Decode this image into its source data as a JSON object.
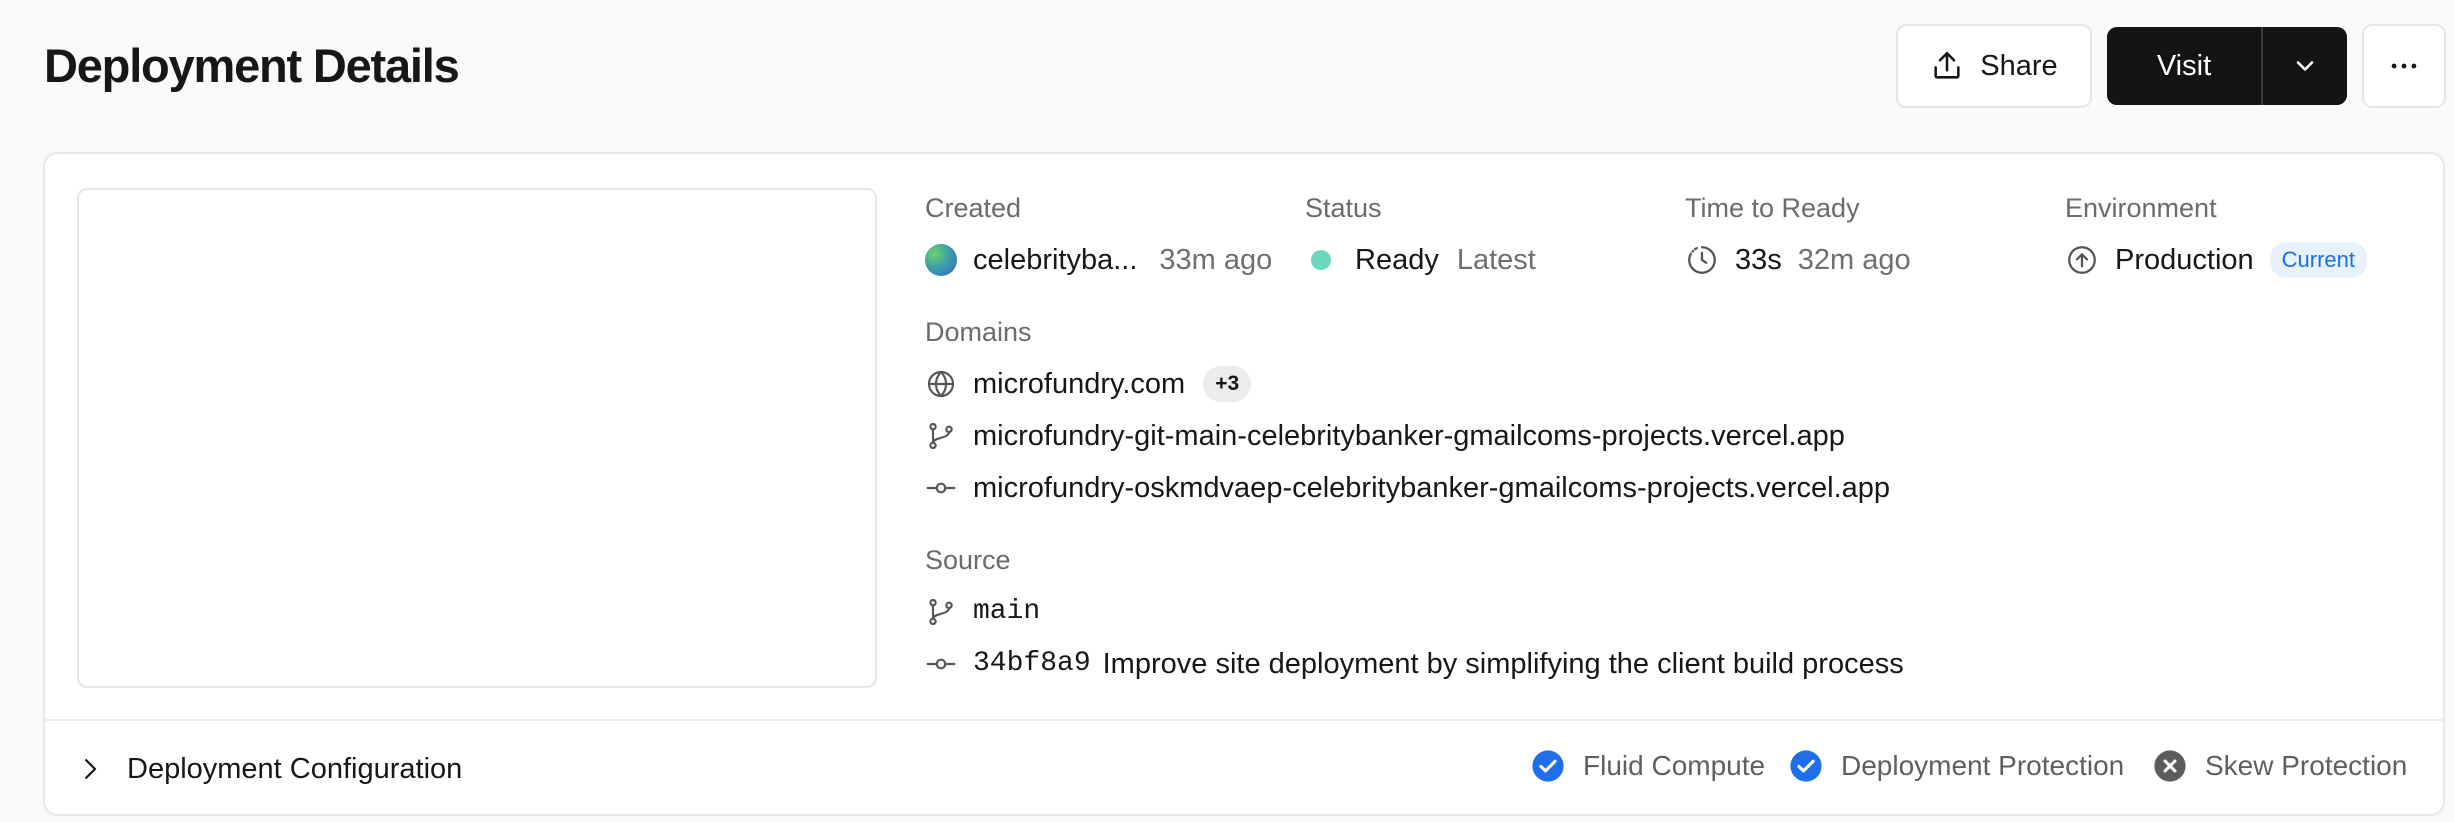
{
  "header": {
    "title": "Deployment Details",
    "share_label": "Share",
    "visit_label": "Visit"
  },
  "overview": {
    "created": {
      "label": "Created",
      "author": "celebrityba...",
      "time": "33m ago"
    },
    "status": {
      "label": "Status",
      "value": "Ready",
      "tag": "Latest",
      "color": "#6ad9c0"
    },
    "time_to_ready": {
      "label": "Time to Ready",
      "duration": "33s",
      "time": "32m ago"
    },
    "environment": {
      "label": "Environment",
      "value": "Production",
      "badge": "Current"
    }
  },
  "domains": {
    "label": "Domains",
    "primary": "microfundry.com",
    "extra_count": "+3",
    "branch_url": "microfundry-git-main-celebritybanker-gmailcoms-projects.vercel.app",
    "deployment_url": "microfundry-oskmdvaep-celebritybanker-gmailcoms-projects.vercel.app"
  },
  "source": {
    "label": "Source",
    "branch": "main",
    "commit_sha": "34bf8a9",
    "commit_message": "Improve site deployment by simplifying the client build process"
  },
  "configuration": {
    "title": "Deployment Configuration",
    "features": [
      {
        "label": "Fluid Compute",
        "enabled": true
      },
      {
        "label": "Deployment Protection",
        "enabled": true
      },
      {
        "label": "Skew Protection",
        "enabled": false
      }
    ]
  },
  "colors": {
    "accent_blue": "#1f6feb",
    "disabled_gray": "#5c5c5c",
    "current_badge_bg": "#e8f2ff",
    "current_badge_text": "#1a6ee6"
  },
  "icons": {
    "share": "share-icon",
    "chevron_down": "chevron-down-icon",
    "more": "more-horizontal-icon",
    "clock": "clock-icon",
    "environment": "arrow-up-circle-icon",
    "globe": "globe-icon",
    "branch": "git-branch-icon",
    "commit": "git-commit-icon",
    "chevron_right": "chevron-right-icon",
    "check": "check-circle-icon",
    "x": "x-circle-icon"
  }
}
